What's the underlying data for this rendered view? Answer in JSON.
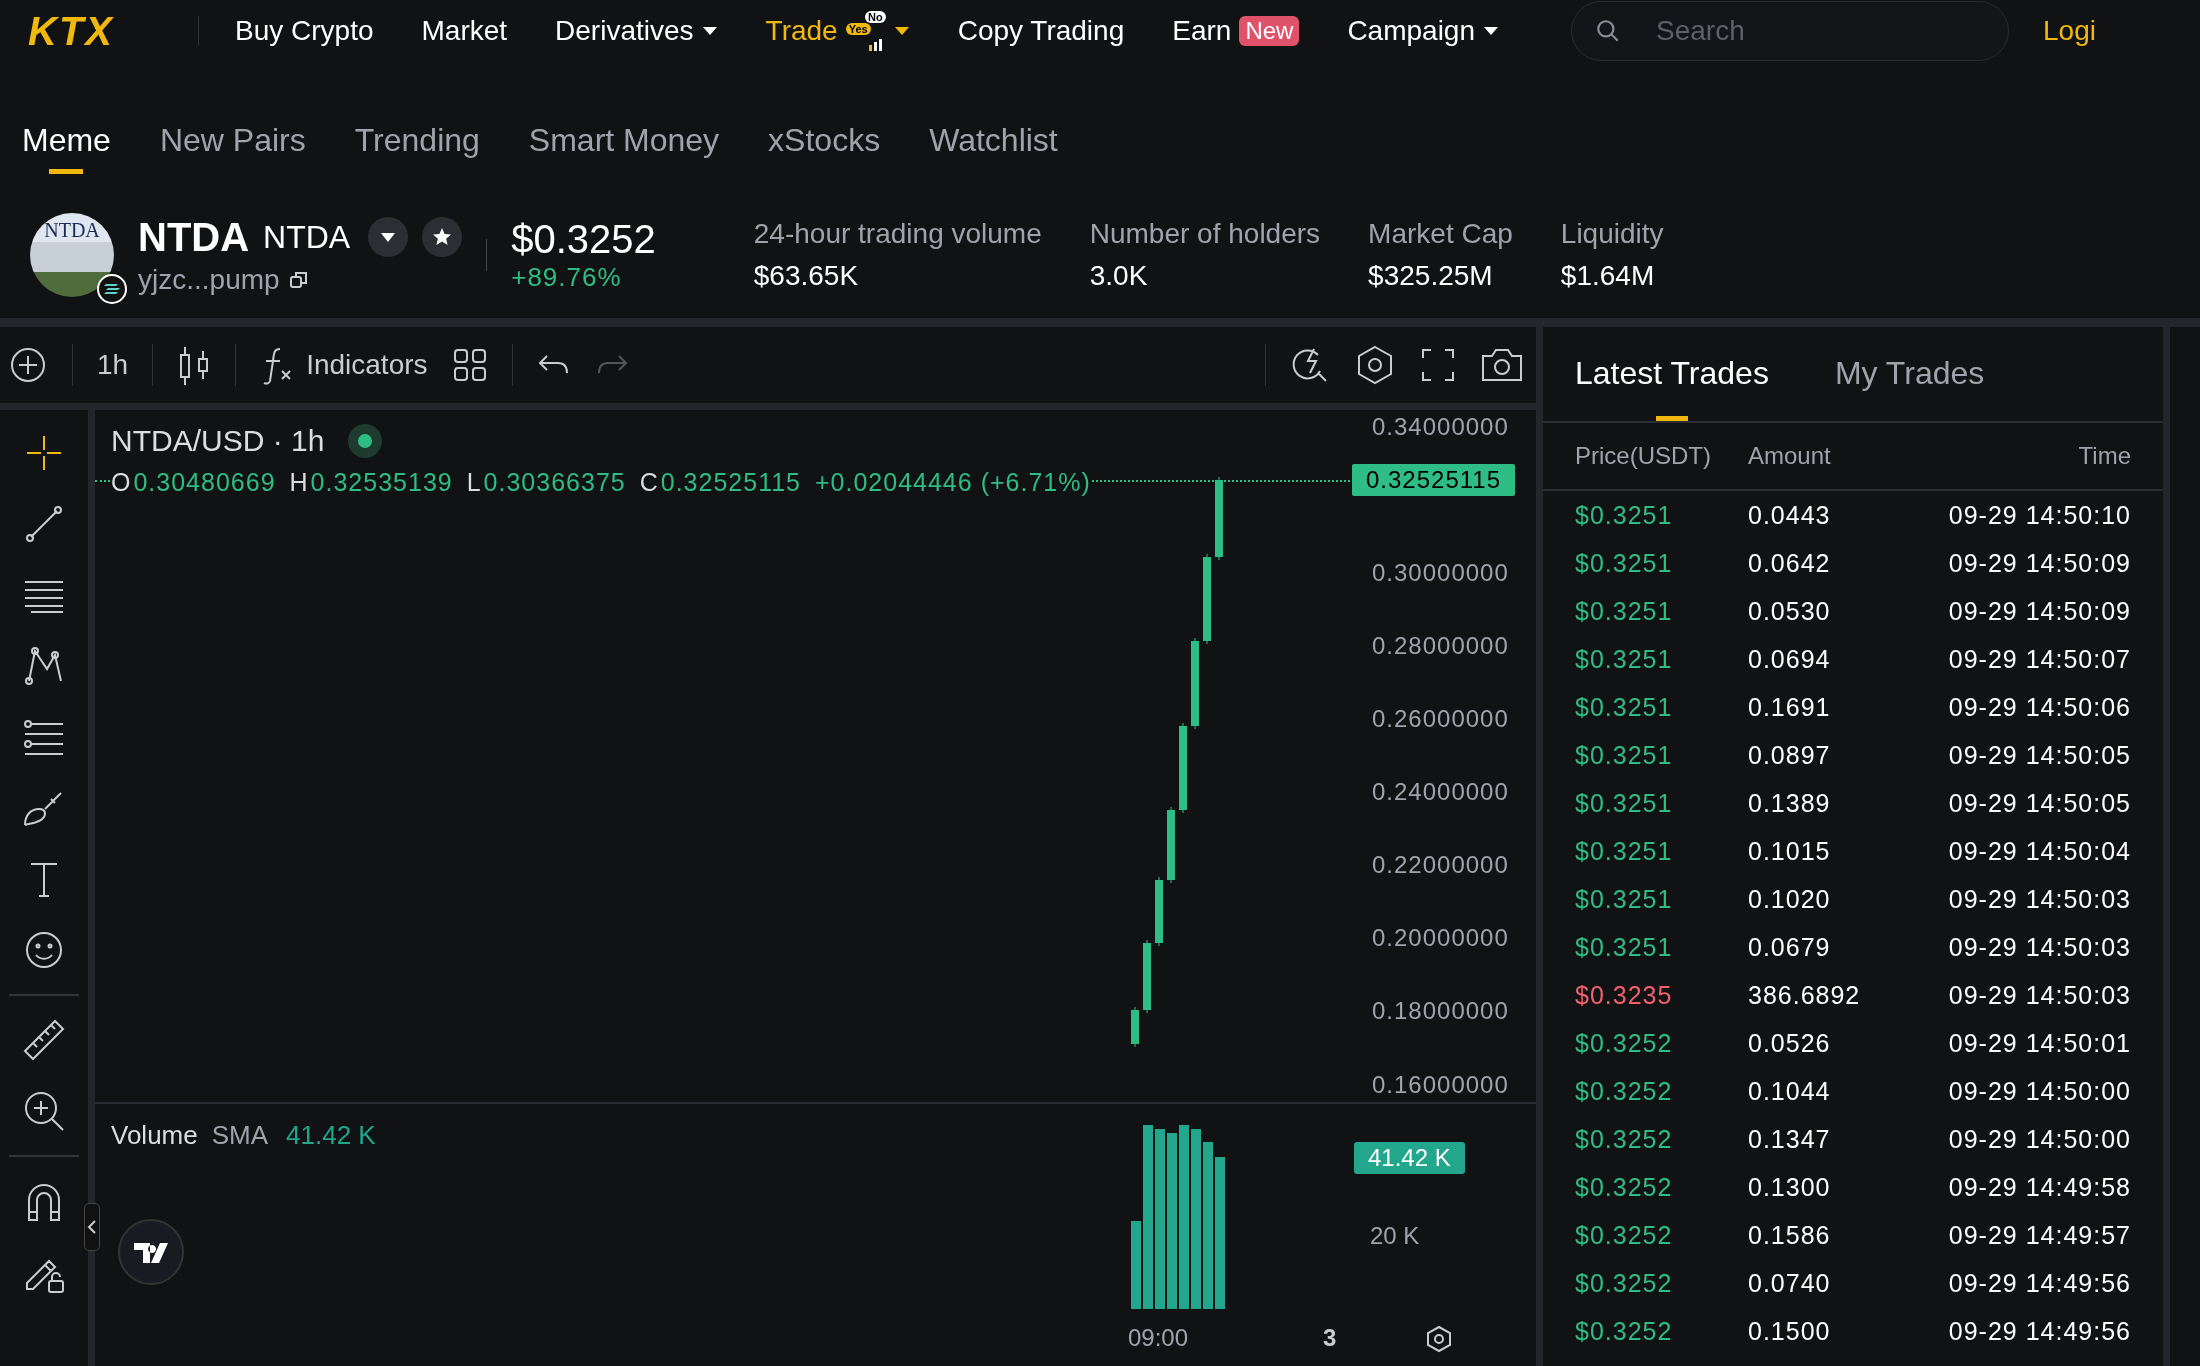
{
  "logo": "KTX",
  "nav": [
    {
      "label": "Buy Crypto",
      "kind": "plain",
      "selected": false
    },
    {
      "label": "Market",
      "kind": "plain",
      "selected": false
    },
    {
      "label": "Derivatives",
      "kind": "dropdown",
      "selected": false
    },
    {
      "label": "Trade",
      "kind": "promo",
      "selected": true,
      "promo_badge": "No",
      "promo_tag": "Yes"
    },
    {
      "label": "Copy Trading",
      "kind": "plain",
      "selected": false
    },
    {
      "label": "Earn",
      "kind": "badge",
      "selected": false,
      "badge": "New"
    },
    {
      "label": "Campaign",
      "kind": "dropdown",
      "selected": false
    }
  ],
  "search": {
    "placeholder": "Search"
  },
  "login": "Logi",
  "subtabs": [
    {
      "label": "Meme",
      "selected": true
    },
    {
      "label": "New Pairs",
      "selected": false
    },
    {
      "label": "Trending",
      "selected": false
    },
    {
      "label": "Smart Money",
      "selected": false
    },
    {
      "label": "xStocks",
      "selected": false
    },
    {
      "label": "Watchlist",
      "selected": false
    }
  ],
  "token": {
    "avatar_text": "NTDA",
    "name": "NTDA",
    "symbol": "NTDA",
    "address": "yjzc...pump",
    "price": "$0.3252",
    "change": "+89.76%",
    "stats": [
      {
        "label": "24-hour trading volume",
        "value": "$63.65K"
      },
      {
        "label": "Number of holders",
        "value": "3.0K"
      },
      {
        "label": "Market Cap",
        "value": "$325.25M"
      },
      {
        "label": "Liquidity",
        "value": "$1.64M"
      }
    ]
  },
  "toolbar": {
    "interval": "1h",
    "indicators": "Indicators"
  },
  "chart": {
    "title": "NTDA/USD · 1h",
    "ohlc": [
      {
        "label": "O",
        "value": "0.30480669"
      },
      {
        "label": "H",
        "value": "0.32535139"
      },
      {
        "label": "L",
        "value": "0.30366375"
      },
      {
        "label": "C",
        "value": "0.32525115"
      }
    ],
    "change": "+0.02044446 (+6.71%)",
    "price_ticks": [
      "0.34000000",
      "0.30000000",
      "0.28000000",
      "0.26000000",
      "0.24000000",
      "0.22000000",
      "0.20000000",
      "0.18000000",
      "0.16000000"
    ],
    "last_price": "0.32525115",
    "volume": {
      "label": "Volume",
      "sma": "SMA",
      "value": "41.42 K",
      "badge": "41.42 K",
      "tick": "20 K"
    },
    "time_ticks": [
      "09:00",
      "3"
    ]
  },
  "trades": {
    "tabs": [
      {
        "label": "Latest Trades",
        "selected": true
      },
      {
        "label": "My Trades",
        "selected": false
      }
    ],
    "columns": [
      "Price(USDT)",
      "Amount",
      "Time"
    ],
    "rows": [
      {
        "price": "$0.3251",
        "amount": "0.0443",
        "time": "09-29 14:50:10",
        "color": "#2ebd85"
      },
      {
        "price": "$0.3251",
        "amount": "0.0642",
        "time": "09-29 14:50:09",
        "color": "#2ebd85"
      },
      {
        "price": "$0.3251",
        "amount": "0.0530",
        "time": "09-29 14:50:09",
        "color": "#2ebd85"
      },
      {
        "price": "$0.3251",
        "amount": "0.0694",
        "time": "09-29 14:50:07",
        "color": "#2ebd85"
      },
      {
        "price": "$0.3251",
        "amount": "0.1691",
        "time": "09-29 14:50:06",
        "color": "#2ebd85"
      },
      {
        "price": "$0.3251",
        "amount": "0.0897",
        "time": "09-29 14:50:05",
        "color": "#2ebd85"
      },
      {
        "price": "$0.3251",
        "amount": "0.1389",
        "time": "09-29 14:50:05",
        "color": "#2ebd85"
      },
      {
        "price": "$0.3251",
        "amount": "0.1015",
        "time": "09-29 14:50:04",
        "color": "#2ebd85"
      },
      {
        "price": "$0.3251",
        "amount": "0.1020",
        "time": "09-29 14:50:03",
        "color": "#2ebd85"
      },
      {
        "price": "$0.3251",
        "amount": "0.0679",
        "time": "09-29 14:50:03",
        "color": "#2ebd85"
      },
      {
        "price": "$0.3235",
        "amount": "386.6892",
        "time": "09-29 14:50:03",
        "color": "#f0616d"
      },
      {
        "price": "$0.3252",
        "amount": "0.0526",
        "time": "09-29 14:50:01",
        "color": "#2ebd85"
      },
      {
        "price": "$0.3252",
        "amount": "0.1044",
        "time": "09-29 14:50:00",
        "color": "#2ebd85"
      },
      {
        "price": "$0.3252",
        "amount": "0.1347",
        "time": "09-29 14:50:00",
        "color": "#2ebd85"
      },
      {
        "price": "$0.3252",
        "amount": "0.1300",
        "time": "09-29 14:49:58",
        "color": "#2ebd85"
      },
      {
        "price": "$0.3252",
        "amount": "0.1586",
        "time": "09-29 14:49:57",
        "color": "#2ebd85"
      },
      {
        "price": "$0.3252",
        "amount": "0.0740",
        "time": "09-29 14:49:56",
        "color": "#2ebd85"
      },
      {
        "price": "$0.3252",
        "amount": "0.1500",
        "time": "09-29 14:49:56",
        "color": "#2ebd85"
      }
    ]
  }
}
